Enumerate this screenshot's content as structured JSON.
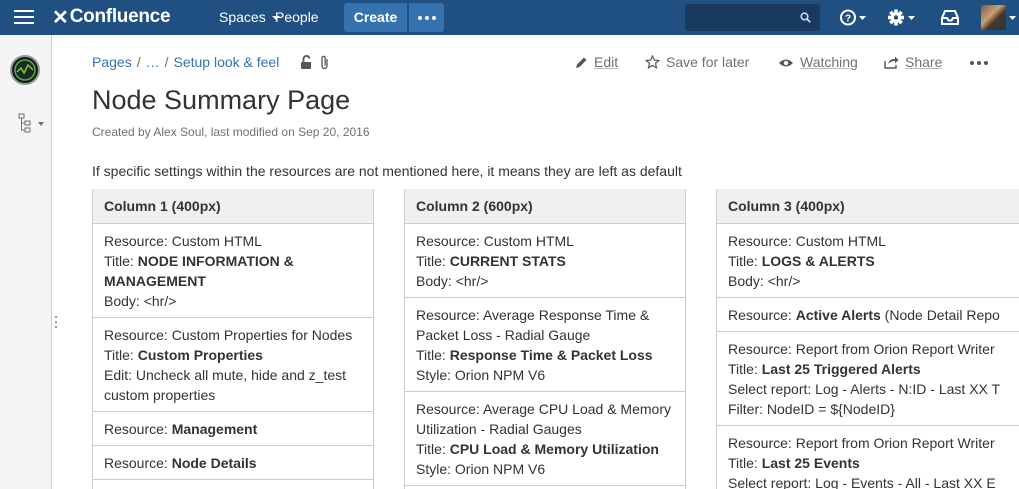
{
  "topbar": {
    "logo_x": "✕",
    "logo_text": "Confluence",
    "spaces_label": "Spaces",
    "people_label": "People",
    "create_label": "Create"
  },
  "breadcrumb": {
    "pages": "Pages",
    "ellipsis": "…",
    "parent": "Setup look & feel"
  },
  "page_actions": {
    "edit": "Edit",
    "save_for_later": "Save for later",
    "watching": "Watching",
    "share": "Share"
  },
  "page": {
    "title": "Node Summary Page",
    "meta": "Created by Alex Soul, last modified on Sep 20, 2016",
    "intro": "If specific settings within the resources are not mentioned here, it means they are left as default"
  },
  "columns": [
    {
      "header": "Column 1 (400px)",
      "cells": [
        [
          {
            "label": "Resource: ",
            "value": "Custom HTML"
          },
          {
            "label": "Title: ",
            "bold": "NODE INFORMATION &"
          },
          {
            "bold": "MANAGEMENT"
          },
          {
            "label": "Body: ",
            "value": "<hr/>"
          }
        ],
        [
          {
            "label": "Resource: ",
            "value": "Custom Properties for Nodes"
          },
          {
            "label": "Title: ",
            "bold": "Custom Properties"
          },
          {
            "label": "Edit: ",
            "value": "Uncheck all mute, hide and z_test"
          },
          {
            "value": "custom properties"
          }
        ],
        [
          {
            "label": "Resource: ",
            "bold": "Management"
          }
        ],
        [
          {
            "label": "Resource: ",
            "bold": "Node Details"
          }
        ]
      ]
    },
    {
      "header": "Column 2 (600px)",
      "cells": [
        [
          {
            "label": "Resource: ",
            "value": "Custom HTML"
          },
          {
            "label": "Title: ",
            "bold": "CURRENT STATS"
          },
          {
            "label": "Body: ",
            "value": "<hr/>"
          }
        ],
        [
          {
            "label": "Resource: ",
            "value": "Average Response Time &"
          },
          {
            "value": "Packet Loss - Radial Gauge"
          },
          {
            "label": "Title: ",
            "bold": "Response Time & Packet Loss"
          },
          {
            "label": " Style: ",
            "value": "Orion NPM V6"
          }
        ],
        [
          {
            "label": "Resource: ",
            "value": "Average CPU Load & Memory"
          },
          {
            "value": "Utilization - Radial Gauges"
          },
          {
            "label": "Title: ",
            "bold": "CPU Load & Memory Utilization"
          },
          {
            "label": " Style: ",
            "value": "Orion NPM V6"
          }
        ]
      ]
    },
    {
      "header": "Column 3 (400px)",
      "cells": [
        [
          {
            "label": "Resource: ",
            "value": "Custom HTML"
          },
          {
            "label": "Title: ",
            "bold": "LOGS & ALERTS"
          },
          {
            "label": "Body: ",
            "value": "<hr/>"
          }
        ],
        [
          {
            "label": "Resource: ",
            "bold": "Active Alerts",
            "value": " (Node Detail Repo"
          }
        ],
        [
          {
            "label": "Resource: ",
            "value": "Report from Orion Report Writer"
          },
          {
            "label": "Title: ",
            "bold": "Last 25 Triggered Alerts"
          },
          {
            "label": "Select report: ",
            "value": "Log - Alerts - N:ID - Last XX T"
          },
          {
            "label": "Filter: ",
            "value": "NodeID = ${NodeID}"
          }
        ],
        [
          {
            "label": "Resource: ",
            "value": "Report from Orion Report Writer"
          },
          {
            "label": "Title: ",
            "bold": "Last 25 Events"
          },
          {
            "label": "Select report: ",
            "value": "Log - Events - All - Last XX E"
          }
        ]
      ]
    }
  ]
}
